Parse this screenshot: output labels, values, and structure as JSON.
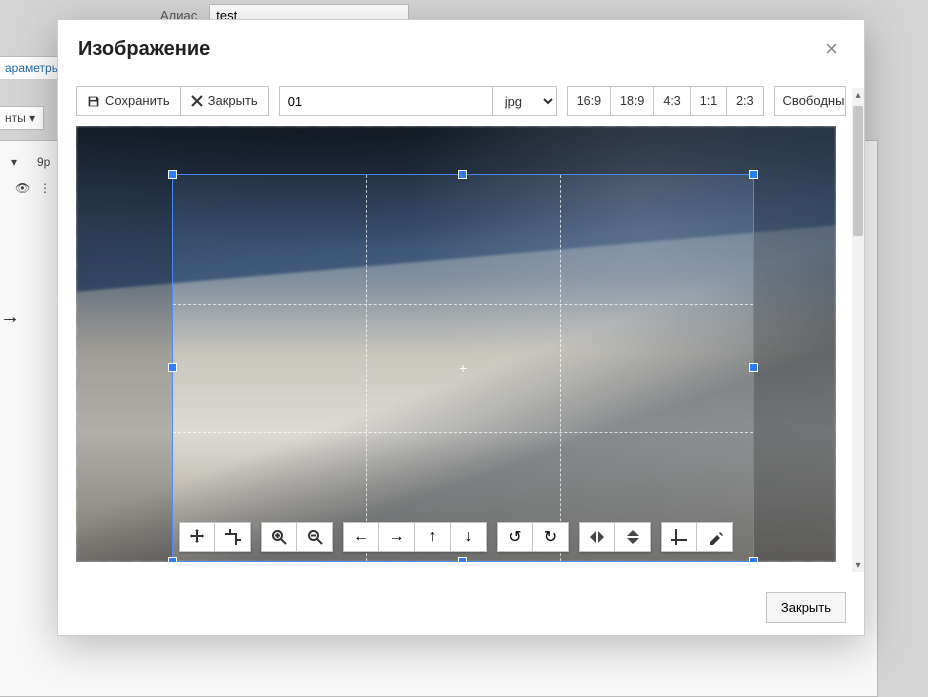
{
  "background": {
    "alias_label": "Алиас",
    "alias_value": "test",
    "params_tab": "араметры",
    "items_dropdown": "нты ▾",
    "row_count": "9p",
    "caret": "▾"
  },
  "modal": {
    "title": "Изображение",
    "save_label": "Сохранить",
    "close_label": "Закрыть",
    "filename": "01",
    "ext": "jpg",
    "ratios": [
      "16:9",
      "18:9",
      "4:3",
      "1:1",
      "2:3"
    ],
    "free_label": "Свободны",
    "footer_close": "Закрыть"
  },
  "tools": {
    "move": "move",
    "crop_sel": "crop",
    "zoom_in": "zoom-in",
    "zoom_out": "zoom-out",
    "left": "←",
    "right": "→",
    "up": "↑",
    "down": "↓",
    "rotate_ccw": "↺",
    "rotate_cw": "↻",
    "flip_h": "flip-h",
    "flip_v": "flip-v",
    "crop": "crop",
    "clear": "clear"
  }
}
